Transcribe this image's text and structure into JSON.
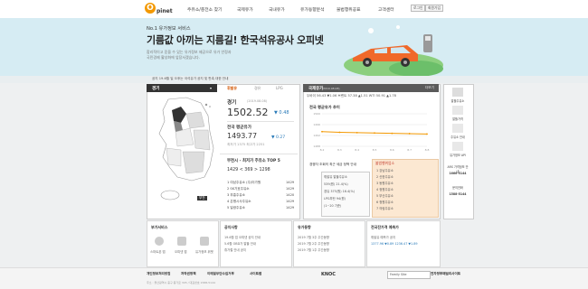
{
  "brand": {
    "logo_letter": "O",
    "logo_text": "pinet"
  },
  "nav": {
    "items": [
      "주유소/충전소 찾기",
      "국제유가",
      "국내유가",
      "유가동향분석",
      "불법행위공표",
      "고객센터"
    ],
    "buttons": [
      "로그인",
      "회원가입"
    ]
  },
  "hero": {
    "subtitle": "No.1 유가정보 서비스",
    "title": "기름값 아끼는 지름길! 한국석유공사 오피넷",
    "desc_line1": "합리적이고 믿을 수 있는 유가정보 제공으로 유가 안정과",
    "desc_line2": "국민경제 활성화에 앞장서겠습니다."
  },
  "ticker": {
    "text": "공지   19.6월 일 오후는 국석유가 공지 및 판촉 대한 안내"
  },
  "left_panel": {
    "header": "경기",
    "tabs": [
      "휘발유",
      "경유",
      "LPG"
    ],
    "region": "경기",
    "region_date": "(2019.08.08)",
    "price": "1502.52",
    "price_change": "▼ 0.48",
    "national_label": "전국 평균유가",
    "national_price": "1493.77",
    "national_change": "▼ 0.27",
    "national_range": "최저가  1375    최고가  2251",
    "bucheon_label": "부천시 - 최저가 주유소 TOP 5",
    "bucheon_prices": "1429  <  369  >  1298",
    "stations": [
      {
        "name": "1  여남주유소 (주)미가원",
        "price": "1429"
      },
      {
        "name": "2  SK가호주유소",
        "price": "1429"
      },
      {
        "name": "3  부흥주유소",
        "price": "1420"
      },
      {
        "name": "4  은평시사주유소",
        "price": "1429"
      },
      {
        "name": "5  일광주유소",
        "price": "1429"
      }
    ],
    "map_label": "부천"
  },
  "mid_panel": {
    "header": "국제유가",
    "header_date": "(2019.08.08)",
    "more": "더보기",
    "oil_row": "두바이  56.43  ▼1.06   브렌트  57.38  ▲1.51   WTI  50.91  ▲1.78",
    "chart_title": "전국 평균유가 추이",
    "cheap_label": "경쟁자 조회의 최근 세금 정책 안내",
    "cheap_rows": [
      "휘발유 알뜰주유소",
      "539(원)  21.4(%)",
      "경유  375(원)  16.4(%)",
      "LPG부탄  94(원)",
      "  (1~20 기준)"
    ],
    "cheap_right_label": "불법행위업소",
    "cheap_right_rows": [
      "1  강남주유소",
      "2  신한주유소",
      "3  동원주유소",
      "4  정원주유소",
      "5  부산주유소",
      "6  청원주유소",
      "7  의림주유소"
    ]
  },
  "chart_data": {
    "type": "line",
    "title": "전국 평균유가 추이",
    "categories": [
      "8.2",
      "8.3",
      "8.4",
      "8.5",
      "8.6",
      "8.7",
      "8.8"
    ],
    "series": [
      {
        "name": "",
        "values": [
          1494.5,
          1494.3,
          1494.2,
          1494.1,
          1494.0,
          1493.9,
          1493.77
        ]
      }
    ],
    "ylim": [
      1490,
      1500
    ],
    "yticks": [
      "1500",
      "1496",
      "1492",
      "1488"
    ],
    "grid": true
  },
  "right_side": {
    "items": [
      "알뜰주유소",
      "알뜰가격",
      "주유소 안내",
      "유가정보 API",
      "ARS 가격정보 안내",
      "1666-5144",
      "문의전화",
      "1588-5144"
    ]
  },
  "bottom": {
    "cards": [
      {
        "title": "부가서비스",
        "lines": [
          "스마트폰 앱",
          "오피넷 앱",
          "유가정보 위젯"
        ]
      },
      {
        "title": "공지사항",
        "lines": [
          "19.6월 업 오피넷 공지 안내",
          "5.6월 OBD가 알뜰 안내",
          "휴가철 안내 공지"
        ]
      },
      {
        "title": "유가동향",
        "lines": [
          "2019 7월 3주 주간동향",
          "2019 7월 2주 주간동향",
          "2019 7월 1주 주간동향"
        ]
      },
      {
        "title": "전국잔가격 예측가",
        "lines": [
          "휘발유 예측가 공지",
          "1377.96  ▼0.89  1236.47  ▼1.89"
        ]
      }
    ]
  },
  "footer": {
    "links": [
      "개인정보처리방침",
      "저작권정책",
      "이메일무단수집거부",
      "사이트맵"
    ],
    "address": "주소 : 울산광역시 중구 종가로 305 / 대표번호 1588-5144",
    "org": "KNOC",
    "family_site": "Family Site",
    "extra": "전자정부패밀리사이트"
  },
  "colors": {
    "accent": "#f39800",
    "hero_bg": "#d6ecf3",
    "down": "#2b7bb9",
    "up": "#c0392b"
  }
}
